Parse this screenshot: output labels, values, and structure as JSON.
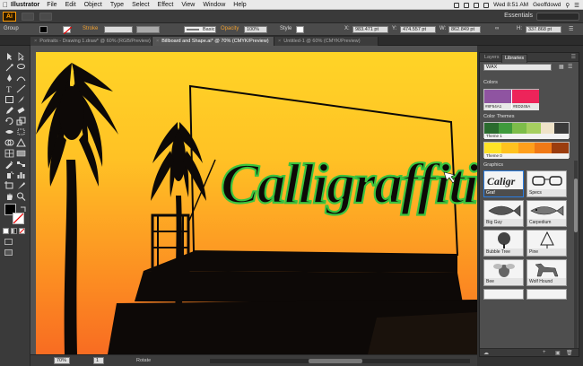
{
  "menubar": {
    "app_name": "Illustrator",
    "items": [
      "File",
      "Edit",
      "Object",
      "Type",
      "Select",
      "Effect",
      "View",
      "Window",
      "Help"
    ],
    "clock": "Wed 8:51 AM",
    "user": "Geoffdowd"
  },
  "appbar": {
    "logo": "Ai",
    "workspace": "Essentials"
  },
  "control": {
    "selection": "Group",
    "stroke_label": "Stroke",
    "stroke_style": "Basic",
    "opacity_label": "Opacity",
    "opacity_value": "100%",
    "style_label": "Style",
    "x_value": "983.471 pt",
    "y_value": "474.557 pt",
    "w_value": "862.849 pt",
    "h_value": "337.868 pt"
  },
  "tabs": [
    {
      "label": "Portraits - Drawing 1.draw* @ 60% (RGB/Preview)",
      "active": false
    },
    {
      "label": "Billboard and Shape.ai* @ 70% (CMYK/Preview)",
      "active": true
    },
    {
      "label": "Untitled-1 @ 60% (CMYK/Preview)",
      "active": false
    }
  ],
  "artwork": {
    "text": "Calligraffiti"
  },
  "statusbar": {
    "zoom": "70%",
    "page": "1",
    "tool": "Rotate"
  },
  "panel": {
    "tabs": [
      "Layers",
      "Libraries"
    ],
    "library": "WAX",
    "colors_heading": "Colors",
    "swatches": [
      {
        "name": "#8F54A1",
        "color": "#8F54A1"
      },
      {
        "name": "#ED245A",
        "color": "#ED245A"
      }
    ],
    "themes_heading": "Color Themes",
    "themes": [
      {
        "name": "Theme 1",
        "colors": [
          "#2a6b2e",
          "#3f9a3c",
          "#7dbd4a",
          "#a6cf60",
          "#efe3c9",
          "#3a3a3a"
        ]
      },
      {
        "name": "Theme 0",
        "colors": [
          "#ffe227",
          "#ffc21f",
          "#ff9f1c",
          "#f07916",
          "#9b3d0f"
        ]
      }
    ],
    "graphics_heading": "Graphics",
    "graphics": [
      {
        "name": "Graf",
        "icon": "graffiti-logo-icon",
        "selected": true
      },
      {
        "name": "Specs",
        "icon": "glasses-icon",
        "selected": false
      },
      {
        "name": "Big Guy",
        "icon": "fish-icon",
        "selected": false
      },
      {
        "name": "Carpedium",
        "icon": "carp-icon",
        "selected": false
      },
      {
        "name": "Bubble Tree",
        "icon": "tree-icon",
        "selected": false
      },
      {
        "name": "Pine",
        "icon": "pine-tree-icon",
        "selected": false
      },
      {
        "name": "Bee",
        "icon": "bee-icon",
        "selected": false
      },
      {
        "name": "Wolf Hound",
        "icon": "dog-icon",
        "selected": false
      }
    ]
  }
}
